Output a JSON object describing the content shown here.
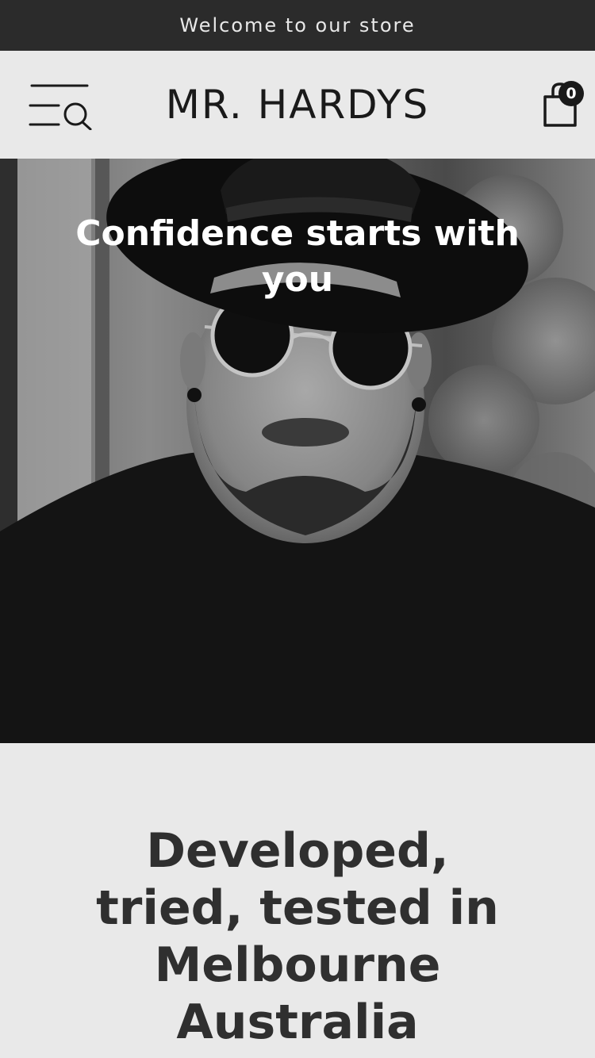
{
  "announcement": {
    "text": "Welcome to our store"
  },
  "header": {
    "logo": "MR. HARDYS",
    "cart_count": "0",
    "icons": {
      "menu": "menu-search-icon",
      "cart": "shopping-bag-icon"
    }
  },
  "hero": {
    "title": "Confidence starts with you",
    "image": "black-and-white photo of a bearded man wearing a fedora hat and round sunglasses"
  },
  "intro": {
    "heading": "Developed, tried, tested in Melbourne Australia"
  },
  "colors": {
    "announcement_bg": "#2b2b2b",
    "page_bg": "#e9e9e9",
    "text_dark": "#1a1a1a",
    "heading": "#2f2f2f"
  }
}
